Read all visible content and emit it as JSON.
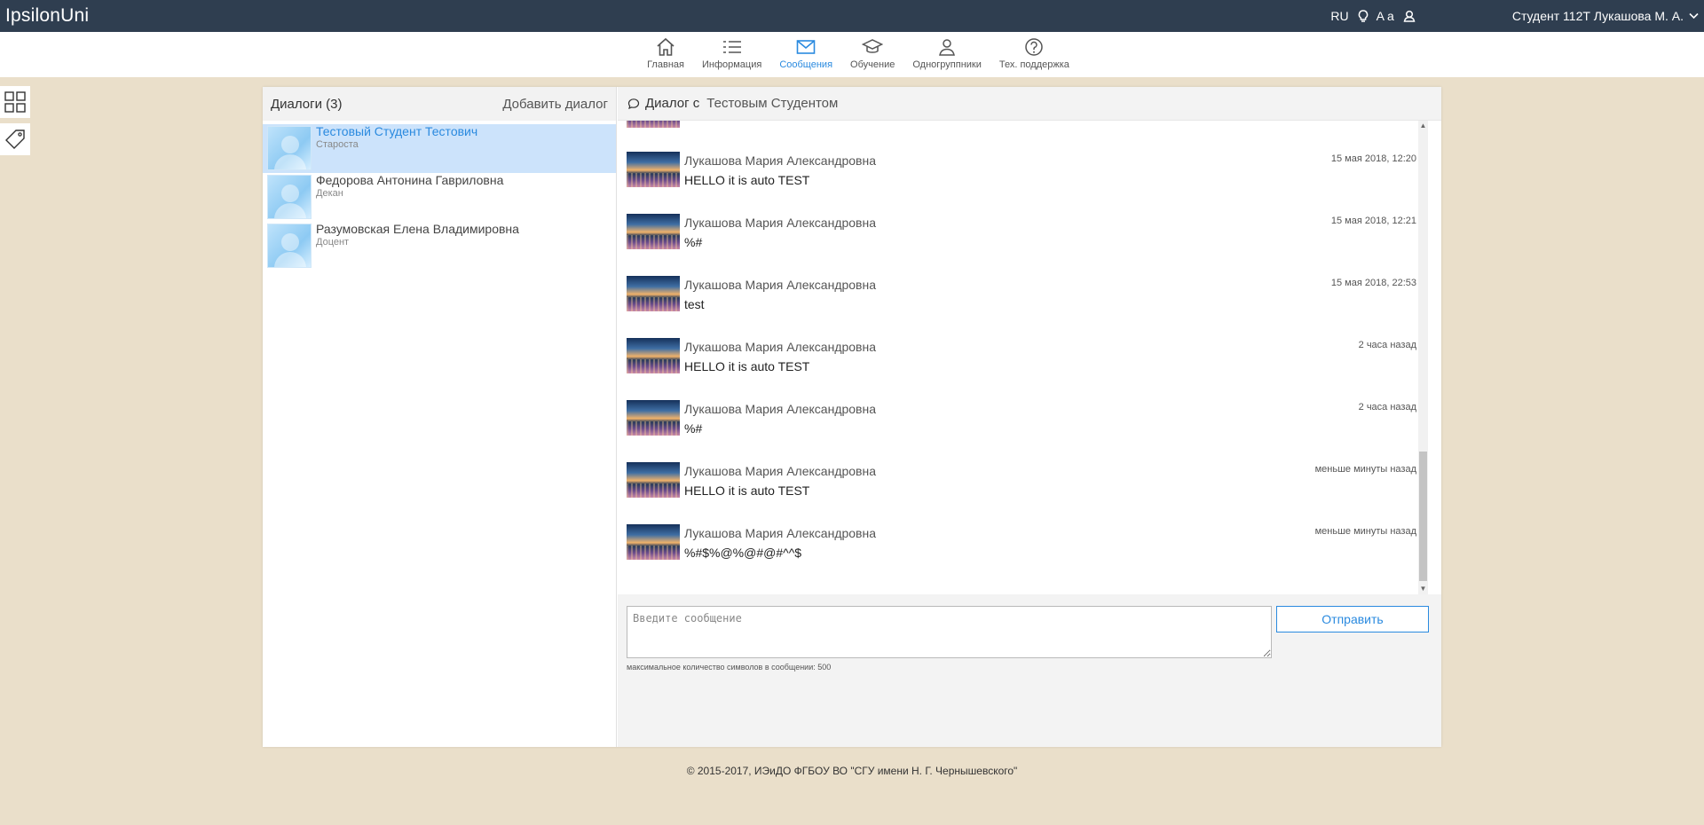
{
  "topbar": {
    "brand": "IpsilonUni",
    "lang": "RU",
    "fontsize_label": "A a",
    "user": "Студент 112Т Лукашова М. А."
  },
  "nav": [
    {
      "label": "Главная",
      "icon": "home-icon",
      "active": false
    },
    {
      "label": "Информация",
      "icon": "list-icon",
      "active": false
    },
    {
      "label": "Сообщения",
      "icon": "envelope-icon",
      "active": true
    },
    {
      "label": "Обучение",
      "icon": "graduation-cap-icon",
      "active": false
    },
    {
      "label": "Одногруппники",
      "icon": "people-icon",
      "active": false
    },
    {
      "label": "Тех. поддержка",
      "icon": "help-icon",
      "active": false
    }
  ],
  "dialogs": {
    "title": "Диалоги (3)",
    "add_label": "Добавить диалог",
    "items": [
      {
        "name": "Тестовый Студент Тестович",
        "role": "Староста",
        "active": true
      },
      {
        "name": "Федорова Антонина Гавриловна",
        "role": "Декан",
        "active": false
      },
      {
        "name": "Разумовская Елена Владимировна",
        "role": "Доцент",
        "active": false
      }
    ]
  },
  "conversation": {
    "label": "Диалог с",
    "partner": "Тестовым Студентом",
    "messages": [
      {
        "author": "Лукашова Мария Александровна",
        "time": "15 мая 2018, 12:20",
        "text": "HELLO it is auto TEST"
      },
      {
        "author": "Лукашова Мария Александровна",
        "time": "15 мая 2018, 12:21",
        "text": "%#"
      },
      {
        "author": "Лукашова Мария Александровна",
        "time": "15 мая 2018, 22:53",
        "text": "test"
      },
      {
        "author": "Лукашова Мария Александровна",
        "time": "2 часа назад",
        "text": "HELLO it is auto TEST"
      },
      {
        "author": "Лукашова Мария Александровна",
        "time": "2 часа назад",
        "text": "%#"
      },
      {
        "author": "Лукашова Мария Александровна",
        "time": "меньше минуты назад",
        "text": "HELLO it is auto TEST"
      },
      {
        "author": "Лукашова Мария Александровна",
        "time": "меньше минуты назад",
        "text": "%#$%@%@#@#^^$"
      }
    ]
  },
  "composer": {
    "placeholder": "Введите сообщение",
    "send_label": "Отправить",
    "limit_text": "максимальное количество символов в сообщении: 500"
  },
  "footer": "© 2015-2017, ИЭиДО ФГБОУ ВО \"СГУ имени Н. Г. Чернышевского\"",
  "colors": {
    "topbar": "#2f3e50",
    "accent": "#2a8adf",
    "background": "#eadfca",
    "selected": "#cce3fb"
  }
}
